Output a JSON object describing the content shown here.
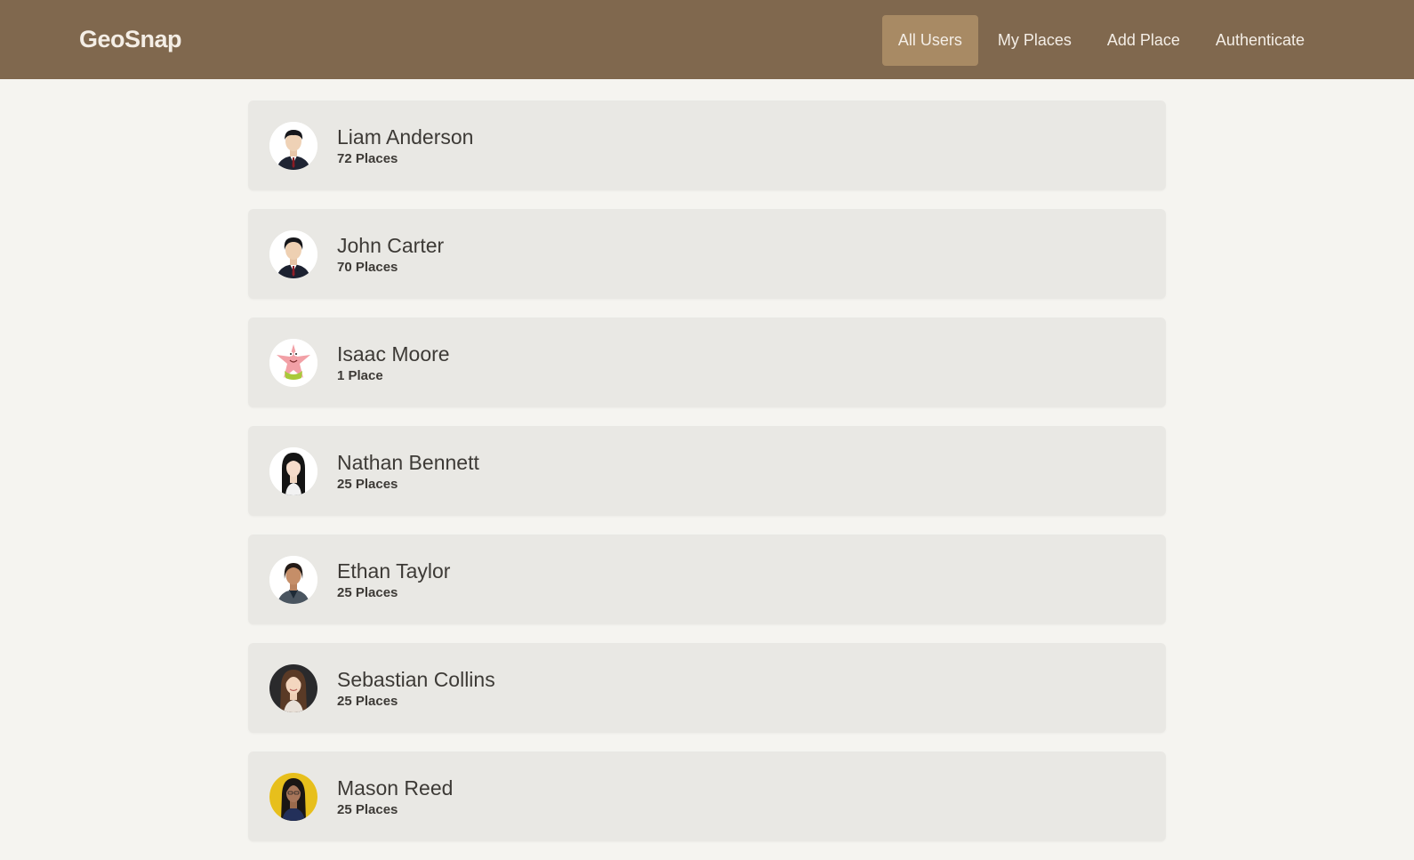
{
  "header": {
    "brand": "GeoSnap",
    "nav": [
      {
        "label": "All Users",
        "active": true
      },
      {
        "label": "My Places",
        "active": false
      },
      {
        "label": "Add Place",
        "active": false
      },
      {
        "label": "Authenticate",
        "active": false
      }
    ]
  },
  "users": [
    {
      "name": "Liam Anderson",
      "places": "72 Places",
      "avatar_icon": "person-suit-avatar-icon"
    },
    {
      "name": "John Carter",
      "places": "70 Places",
      "avatar_icon": "person-suit-avatar-icon"
    },
    {
      "name": "Isaac Moore",
      "places": "1 Place",
      "avatar_icon": "cartoon-starfish-avatar-icon"
    },
    {
      "name": "Nathan Bennett",
      "places": "25 Places",
      "avatar_icon": "person-long-hair-avatar-icon"
    },
    {
      "name": "Ethan Taylor",
      "places": "25 Places",
      "avatar_icon": "person-blazer-avatar-icon"
    },
    {
      "name": "Sebastian Collins",
      "places": "25 Places",
      "avatar_icon": "person-dark-bg-avatar-icon"
    },
    {
      "name": "Mason Reed",
      "places": "25 Places",
      "avatar_icon": "person-yellow-bg-avatar-icon"
    }
  ],
  "colors": {
    "header_bg": "#80684e",
    "active_nav_bg": "#a88a64",
    "page_bg": "#f5f4f0",
    "card_bg": "#e9e8e4"
  }
}
